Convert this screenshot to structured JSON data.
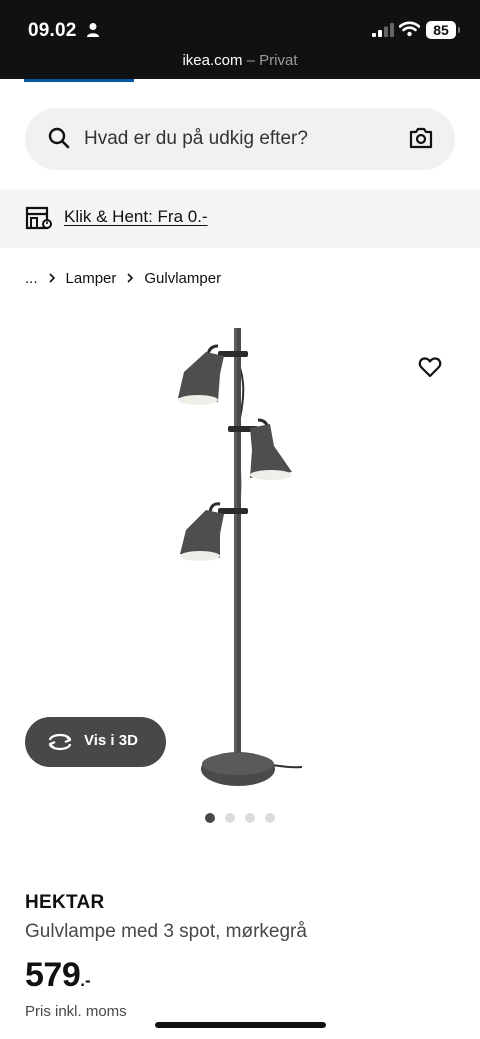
{
  "status_bar": {
    "time": "09.02",
    "battery": "85",
    "url_domain": "ikea.com",
    "url_mode": "– Privat"
  },
  "search": {
    "placeholder": "Hvad er du på udkig efter?"
  },
  "promo": {
    "link_text": "Klik & Hent: Fra 0.-"
  },
  "breadcrumb": {
    "items": [
      "...",
      "Lamper",
      "Gulvlamper"
    ]
  },
  "gallery": {
    "view3d_label": "Vis i 3D",
    "image_count": 4,
    "active_index": 0
  },
  "product": {
    "name": "HEKTAR",
    "description": "Gulvlampe med 3 spot, mørkegrå",
    "price": "579",
    "price_suffix": ".-",
    "vat_note": "Pris inkl. moms"
  },
  "colors": {
    "status_bar_bg": "#111111",
    "ikea_blue": "#0058a3",
    "button_dark": "#484848",
    "search_bg": "#f1f1f1"
  }
}
